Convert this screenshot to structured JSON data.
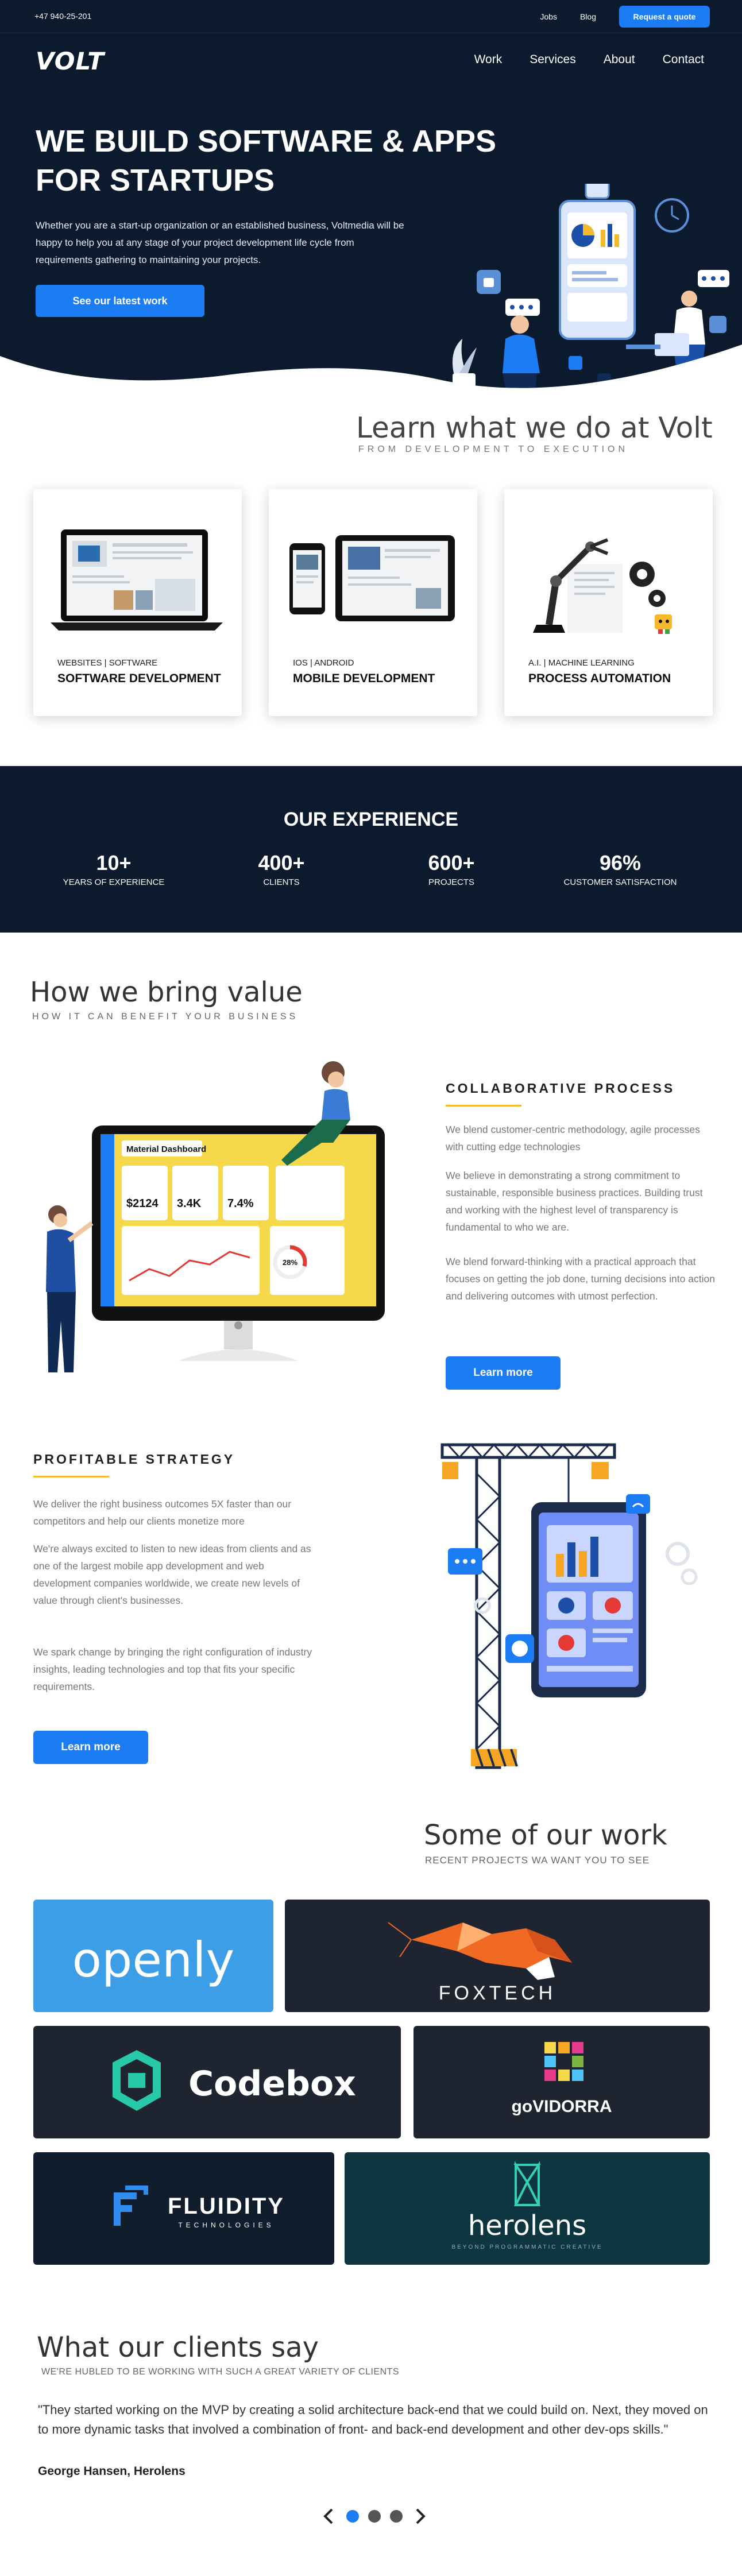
{
  "topbar": {
    "phone": "+47 940-25-201",
    "links": [
      "Jobs",
      "Blog"
    ],
    "quote_button": "Request a quote"
  },
  "brand": {
    "logo": "VOLT"
  },
  "nav": [
    "Work",
    "Services",
    "About",
    "Contact"
  ],
  "hero": {
    "title_line1": "WE BUILD SOFTWARE & APPS",
    "title_line2": "FOR STARTUPS",
    "text": "Whether you are a start-up organization or an established business, Voltmedia will be happy to help you at any stage of your project development life cycle from requirements gathering to maintaining your projects.",
    "button": "See our latest work"
  },
  "services": {
    "title": "Learn what we do at Volt",
    "subtitle": "FROM DEVELOPMENT TO EXECUTION",
    "cards": [
      {
        "tag": "WEBSITES  |  SOFTWARE",
        "title": "SOFTWARE DEVELOPMENT"
      },
      {
        "tag": "IOS  |  ANDROID",
        "title": "MOBILE DEVELOPMENT"
      },
      {
        "tag": "A.I.  |  MACHINE LEARNING",
        "title": "PROCESS AUTOMATION"
      }
    ]
  },
  "experience": {
    "title": "OUR EXPERIENCE",
    "stats": [
      {
        "value": "10+",
        "label": "YEARS OF EXPERIENCE"
      },
      {
        "value": "400+",
        "label": "CLIENTS"
      },
      {
        "value": "600+",
        "label": "PROJECTS"
      },
      {
        "value": "96%",
        "label": "CUSTOMER SATISFACTION"
      }
    ]
  },
  "value": {
    "title": "How we bring value",
    "subtitle": "HOW IT CAN BENEFIT YOUR BUSINESS",
    "collab": {
      "title": "COLLABORATIVE PROCESS",
      "p1": "We blend customer-centric methodology, agile processes with cutting edge technologies",
      "p2": "We believe in demonstrating a strong commitment to sustainable, responsible business practices. Building trust and working with the highest level of transparency is fundamental to who we are.",
      "p3": "We blend forward-thinking with a practical approach that focuses on getting the job done, turning decisions into action and delivering outcomes with utmost perfection.",
      "button": "Learn more"
    },
    "dashboard": {
      "title": "Material Dashboard",
      "v1": "$2124",
      "v2": "3.4K",
      "v3": "7.4%",
      "v4": "28%"
    },
    "profit": {
      "title": "PROFITABLE STRATEGY",
      "p1": "We deliver the right business outcomes 5X faster than our competitors and help our clients monetize more",
      "p2": "We're always excited to listen to new ideas from clients and as one of the largest mobile app development and web development companies worldwide, we create new levels of value through client's businesses.",
      "p3": "We spark change by bringing the right configuration of industry insights, leading technologies and top that fits your specific requirements.",
      "button": "Learn more"
    }
  },
  "work": {
    "title": "Some of our work",
    "subtitle": "RECENT PROJECTS WA WANT YOU TO SEE",
    "projects": [
      {
        "name": "openly",
        "bg": "#3d9ee8"
      },
      {
        "name": "FOXTECH",
        "bg": "#1e2430"
      },
      {
        "name": "Codebox",
        "bg": "#1e2430"
      },
      {
        "name": "goVIDORRA",
        "bg": "#1e2430"
      },
      {
        "name": "FLUIDITY",
        "sub": "TECHNOLOGIES",
        "bg": "#0f1d2d"
      },
      {
        "name": "herolens",
        "sub": "BEYOND PROGRAMMATIC CREATIVE",
        "bg": "#0d3640"
      }
    ]
  },
  "testimonials": {
    "title": "What our clients say",
    "subtitle": "WE'RE HUBLED TO BE WORKING WITH SUCH A GREAT VARIETY OF CLIENTS",
    "quote": "\"They started working on the MVP by creating a solid architecture back-end that we could build on. Next, they moved on to more dynamic tasks that involved a combination of front- and back-end development and other dev-ops skills.\"",
    "author": "George Hansen, Herolens",
    "pages": 3,
    "active_page": 1
  },
  "colors": {
    "navy": "#0b1a2c",
    "blue": "#1c7cf3",
    "accent": "#f6b92b"
  }
}
